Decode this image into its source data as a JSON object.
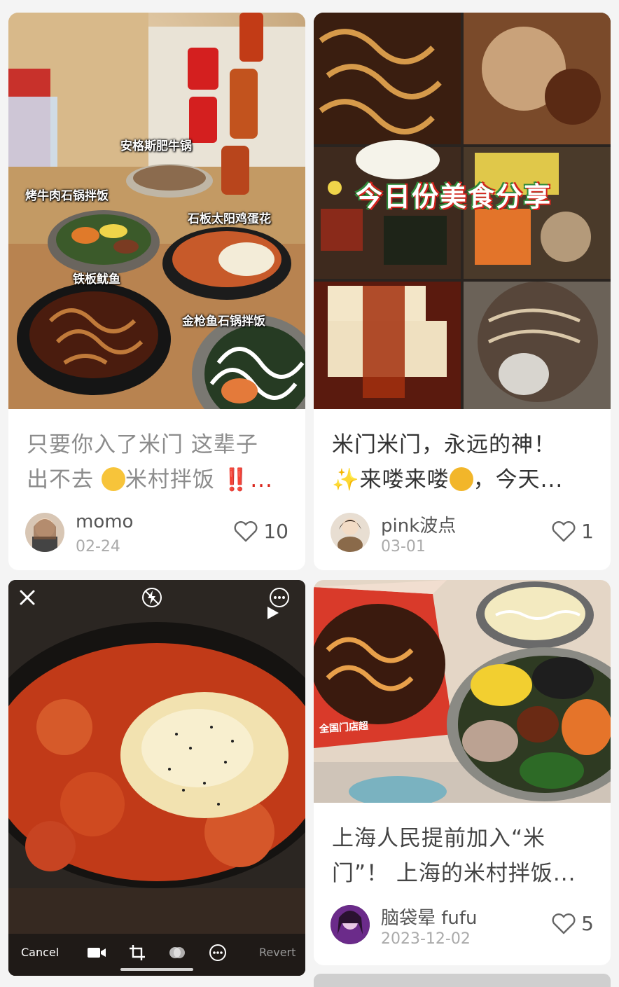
{
  "cards": [
    {
      "title_line1": "只要你入了米门 这辈子",
      "title_line2_a": "出不去",
      "title_line2_b": "米村拌饭",
      "title_line2_c": "‼️...",
      "author": "momo",
      "date": "02-24",
      "likes": "10",
      "dish_labels": [
        "安格斯肥牛锅",
        "烤牛肉石锅拌饭",
        "石板太阳鸡蛋花",
        "铁板鱿鱼",
        "金枪鱼石锅拌饭"
      ],
      "can_labels": [
        "可乐",
        "可乐"
      ]
    },
    {
      "title_line1": "米门米门，永远的神！",
      "title_line2_a": "✨来喽来喽",
      "title_line2_b": "，今天...",
      "author": "pink波点",
      "date": "03-01",
      "likes": "1",
      "banner": "今日份美食分享"
    },
    {
      "editor": {
        "cancel": "Cancel",
        "revert": "Revert"
      }
    },
    {
      "title_line1": "上海人民提前加入“米",
      "title_line2": "门”！ 上海的米村拌饭...",
      "author": "脑袋晕 fufu",
      "date": "2023-12-02",
      "likes": "5",
      "box_text": "全国门店超"
    }
  ],
  "icons": {
    "like": "heart-outline-icon",
    "close": "close-icon",
    "flash": "flash-off-icon",
    "more": "more-icon",
    "play": "play-icon",
    "video": "video-icon",
    "crop": "crop-icon",
    "filter": "filter-icon",
    "adjust": "more-circle-icon"
  }
}
